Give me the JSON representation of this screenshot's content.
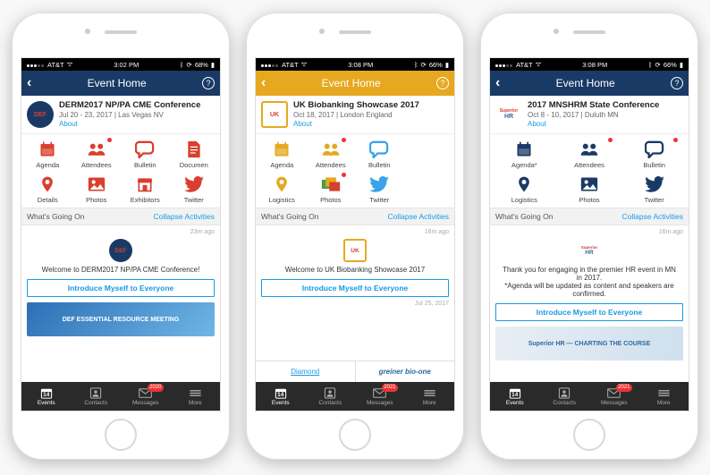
{
  "phones": [
    {
      "accent": "#1a3a66",
      "iconColor": "#d83f2e",
      "status": {
        "carrier": "AT&T",
        "time": "3:02 PM",
        "battery": "68%"
      },
      "header": {
        "title": "Event Home"
      },
      "event": {
        "title": "DERM2017 NP/PA CME Conference",
        "subtitle": "Jul 20 - 23, 2017 | Las Vegas NV",
        "about": "About",
        "logoText": "DEF",
        "logoBg": "#1a3a66",
        "logoFg": "#d83f2e",
        "logoShape": "round"
      },
      "gridCols": 4,
      "grid": [
        {
          "label": "Agenda",
          "icon": "calendar",
          "dot": false
        },
        {
          "label": "Attendees",
          "icon": "people",
          "dot": true
        },
        {
          "label": "Bulletin",
          "icon": "chat",
          "dot": false
        },
        {
          "label": "Documen",
          "icon": "doc",
          "dot": false
        },
        {
          "label": "Details",
          "icon": "pin",
          "dot": false
        },
        {
          "label": "Photos",
          "icon": "photo",
          "dot": false
        },
        {
          "label": "Exhibitors",
          "icon": "store",
          "dot": false
        },
        {
          "label": "Twitter",
          "icon": "twitter",
          "dot": false
        }
      ],
      "section": {
        "title": "What's Going On",
        "collapse": "Collapse Activities"
      },
      "feed": {
        "ago": "23m ago",
        "logoText": "DEF",
        "logoBg": "#1a3a66",
        "logoFg": "#d83f2e",
        "logoShape": "round",
        "welcome": "Welcome to DERM2017 NP/PA CME Conference!",
        "intro": "Introduce Myself to Everyone",
        "bannerText": "DEF ESSENTIAL RESOURCE MEETING",
        "bannerBg": "linear-gradient(135deg,#2d6fb5,#6fb6e6)"
      },
      "sponsorStrip": null,
      "tabs": [
        {
          "label": "Events",
          "icon": "calendar",
          "active": true,
          "badge": "14"
        },
        {
          "label": "Contacts",
          "icon": "contacts",
          "active": false
        },
        {
          "label": "Messages",
          "icon": "mail",
          "active": false,
          "badge": "2020"
        },
        {
          "label": "More",
          "icon": "more",
          "active": false
        }
      ]
    },
    {
      "accent": "#e6a81f",
      "iconColor": "#e6a81f",
      "status": {
        "carrier": "AT&T",
        "time": "3:08 PM",
        "battery": "66%"
      },
      "header": {
        "title": "Event Home"
      },
      "event": {
        "title": "UK Biobanking Showcase 2017",
        "subtitle": "Oct 18, 2017 | London England",
        "about": "About",
        "logoText": "UK",
        "logoBg": "#fff",
        "logoBorder": "#e6a81f",
        "logoFg": "#d83f2e",
        "logoShape": "square"
      },
      "gridCols": 4,
      "grid": [
        {
          "label": "Agenda",
          "icon": "calendar",
          "dot": false
        },
        {
          "label": "Attendees",
          "icon": "people",
          "dot": true
        },
        {
          "label": "Bulletin",
          "icon": "chat",
          "dot": false,
          "color": "#3aa3e8"
        },
        {
          "label": "",
          "icon": "",
          "dot": false
        },
        {
          "label": "Logistics",
          "icon": "pin",
          "dot": false
        },
        {
          "label": "Photos",
          "icon": "photo",
          "dot": true,
          "multi": true
        },
        {
          "label": "Twitter",
          "icon": "twitter",
          "dot": false,
          "color": "#3aa3e8"
        },
        {
          "label": "",
          "icon": "",
          "dot": false
        }
      ],
      "section": {
        "title": "What's Going On",
        "collapse": "Collapse Activities"
      },
      "feed": {
        "ago": "16m ago",
        "logoText": "UK",
        "logoBg": "#fff",
        "logoBorder": "#e6a81f",
        "logoFg": "#d83f2e",
        "logoShape": "square",
        "welcome": "Welcome to UK Biobanking Showcase 2017",
        "intro": "Introduce Myself to Everyone",
        "ago2": "Jul 25, 2017"
      },
      "sponsorStrip": {
        "left": "Diamond",
        "right": "greiner bio-one"
      },
      "tabs": [
        {
          "label": "Events",
          "icon": "calendar",
          "active": true,
          "badge": "14"
        },
        {
          "label": "Contacts",
          "icon": "contacts",
          "active": false
        },
        {
          "label": "Messages",
          "icon": "mail",
          "active": false,
          "badge": "2021"
        },
        {
          "label": "More",
          "icon": "more",
          "active": false
        }
      ]
    },
    {
      "accent": "#1a3a66",
      "iconColor": "#1a3a66",
      "status": {
        "carrier": "AT&T",
        "time": "3:08 PM",
        "battery": "66%"
      },
      "header": {
        "title": "Event Home"
      },
      "event": {
        "title": "2017 MNSHRM State Conference",
        "subtitle": "Oct 8 - 10, 2017 | Duluth MN",
        "about": "About",
        "logoText": "HR",
        "logoBg": "#fff",
        "logoFg": "#2b6aa0",
        "logoShape": "square",
        "logoPrefix": "Superior"
      },
      "gridCols": 3,
      "grid": [
        {
          "label": "Agenda*",
          "icon": "calendar",
          "dot": false
        },
        {
          "label": "Attendees",
          "icon": "people",
          "dot": true
        },
        {
          "label": "Bulletin",
          "icon": "chat",
          "dot": true
        },
        {
          "label": "Logistics",
          "icon": "pin",
          "dot": false
        },
        {
          "label": "Photos",
          "icon": "photo",
          "dot": false
        },
        {
          "label": "Twitter",
          "icon": "twitter",
          "dot": false
        }
      ],
      "section": {
        "title": "What's Going On",
        "collapse": "Collapse Activities"
      },
      "feed": {
        "ago": "16m ago",
        "logoText": "HR",
        "logoBg": "#fff",
        "logoFg": "#2b6aa0",
        "logoShape": "square",
        "logoPrefix": "Superior",
        "welcome": "Thank you for engaging in the premier HR event in MN in 2017.\n*Agenda will be updated as content and speakers are confirmed.",
        "intro": "Introduce Myself to Everyone",
        "bannerText": "Superior HR — CHARTING THE COURSE",
        "bannerBg": "linear-gradient(90deg,#e8eef4,#cfe0ee)",
        "bannerFg": "#2b6aa0"
      },
      "sponsorStrip": null,
      "tabs": [
        {
          "label": "Events",
          "icon": "calendar",
          "active": true,
          "badge": "14"
        },
        {
          "label": "Contacts",
          "icon": "contacts",
          "active": false
        },
        {
          "label": "Messages",
          "icon": "mail",
          "active": false,
          "badge": "2021"
        },
        {
          "label": "More",
          "icon": "more",
          "active": false
        }
      ]
    }
  ]
}
